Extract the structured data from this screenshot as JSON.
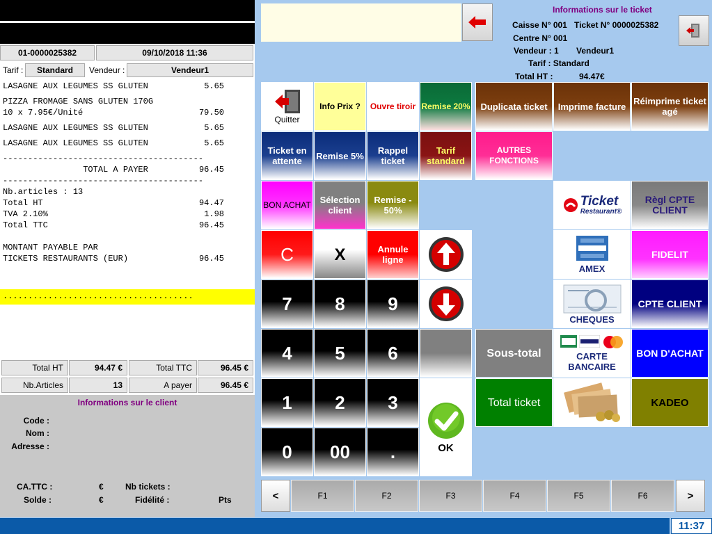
{
  "receipt": {
    "ticket_id": "01-0000025382",
    "datetime": "09/10/2018 11:36",
    "tarif_label": "Tarif :",
    "tarif_value": "Standard",
    "vendeur_label": "Vendeur :",
    "vendeur_value": "Vendeur1",
    "lines": [
      {
        "left": "LASAGNE AUX LEGUMES SS GLUTEN",
        "right": "5.65"
      },
      {
        "left": "PIZZA FROMAGE SANS GLUTEN 170G",
        "right": ""
      },
      {
        "left": "10 x 7.95€/Unité",
        "right": "79.50"
      },
      {
        "left": "LASAGNE AUX LEGUMES SS GLUTEN",
        "right": "5.65"
      },
      {
        "left": "LASAGNE AUX LEGUMES SS GLUTEN",
        "right": "5.65"
      },
      {
        "left": "----------------------------------------",
        "right": ""
      },
      {
        "left": "                TOTAL A PAYER",
        "right": "96.45"
      },
      {
        "left": "----------------------------------------",
        "right": ""
      },
      {
        "left": "Nb.articles : 13",
        "right": ""
      },
      {
        "left": "Total HT",
        "right": "94.47"
      },
      {
        "left": "TVA 2.10%",
        "right": "1.98"
      },
      {
        "left": "Total TTC",
        "right": "96.45"
      },
      {
        "left": "MONTANT PAYABLE PAR",
        "right": ""
      },
      {
        "left": "TICKETS RESTAURANTS (EUR)",
        "right": "96.45"
      }
    ],
    "dots": "......................................"
  },
  "totals": {
    "total_ht_label": "Total HT",
    "total_ht_value": "94.47 €",
    "total_ttc_label": "Total TTC",
    "total_ttc_value": "96.45 €",
    "nb_articles_label": "Nb.Articles",
    "nb_articles_value": "13",
    "a_payer_label": "A payer",
    "a_payer_value": "96.45 €"
  },
  "client": {
    "title": "Informations sur le client",
    "code_label": "Code :",
    "nom_label": "Nom :",
    "adresse_label": "Adresse :",
    "ca_label": "CA.TTC :",
    "ca_unit": "€",
    "nb_tickets_label": "Nb tickets :",
    "solde_label": "Solde :",
    "solde_unit": "€",
    "fidelite_label": "Fidélité :",
    "pts_label": "Pts"
  },
  "ticket_info": {
    "title": "Informations sur le ticket",
    "caisse": "Caisse N° 001",
    "ticket": "Ticket N° 0000025382",
    "centre": "Centre N° 001",
    "vendeur_num": "Vendeur : 1",
    "vendeur_name": "Vendeur1",
    "tarif": "Tarif : Standard",
    "total_ht_label": "Total HT :",
    "total_ht_value": "94.47€"
  },
  "buttons": {
    "quitter": "Quitter",
    "info_prix": "Info Prix ?",
    "ouvre_tiroir": "Ouvre tiroir",
    "remise20": "Remise 20%",
    "duplicata": "Duplicata ticket",
    "imprime_facture": "Imprime facture",
    "reimprime": "Réimprime ticket agé",
    "ticket_attente": "Ticket en attente",
    "remise5": "Remise 5%",
    "rappel": "Rappel ticket",
    "tarif_standard": "Tarif standard",
    "autres": "AUTRES FONCTIONS",
    "bon_achat_small": "BON ACHAT",
    "selection_client": "Sélection client",
    "remise50": "Remise - 50%",
    "regl_cpte": "Règl CPTE CLIENT",
    "clear": "C",
    "times": "X",
    "annule": "Annule ligne",
    "k7": "7",
    "k8": "8",
    "k9": "9",
    "k4": "4",
    "k5": "5",
    "k6": "6",
    "k1": "1",
    "k2": "2",
    "k3": "3",
    "k0": "0",
    "k00": "00",
    "kdot": ".",
    "ok": "OK",
    "sous_total": "Sous-total",
    "total_ticket": "Total ticket",
    "amex": "AMEX",
    "cheques": "CHEQUES",
    "carte": "CARTE BANCAIRE",
    "fidelit": "FIDELIT",
    "cpte_client": "CPTE CLIENT",
    "bon_achat": "BON D'ACHAT",
    "kadeo": "KADEO",
    "ticket_resto_brand": "Ticket",
    "ticket_resto_sub": "Restaurant®"
  },
  "fkeys": {
    "prev": "<",
    "next": ">",
    "items": [
      "F1",
      "F2",
      "F3",
      "F4",
      "F5",
      "F6"
    ]
  },
  "status": {
    "time": "11:37"
  },
  "colors": {
    "accent_blue": "#0b5aa8",
    "info_purple": "#800080",
    "highlight_yellow": "#ffff00"
  }
}
